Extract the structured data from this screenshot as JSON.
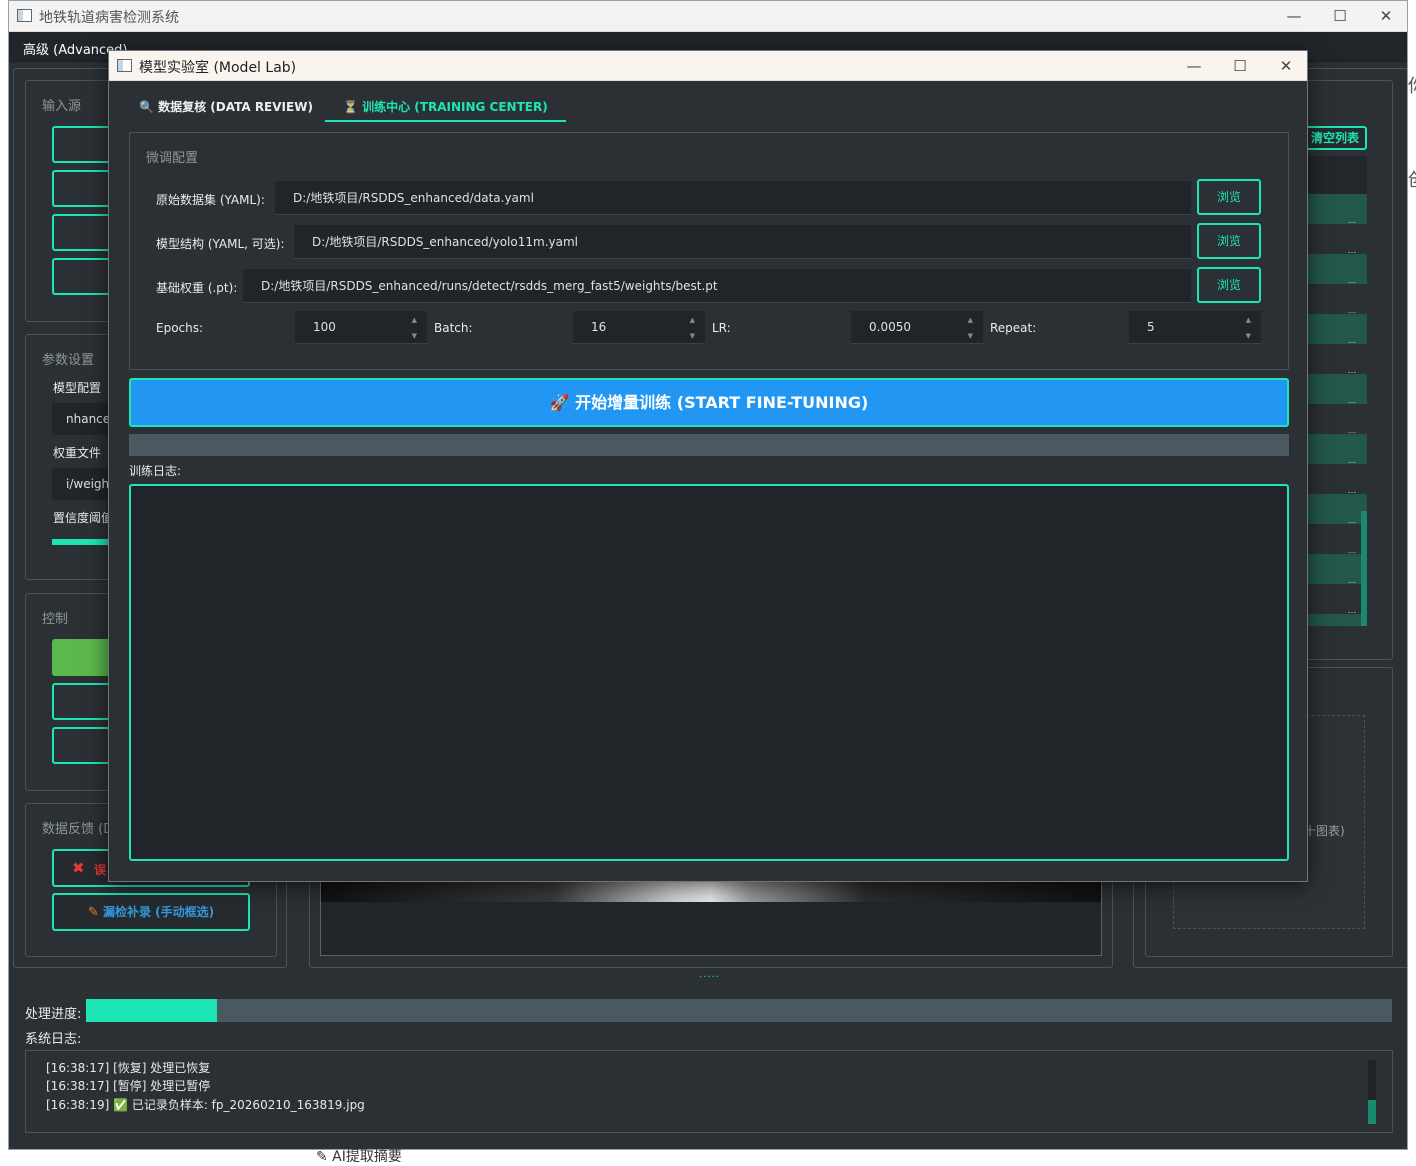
{
  "main_window": {
    "title": "地铁轨道病害检测系统",
    "menu": "高级 (Advanced)",
    "left_panel": {
      "input_group": "输入源",
      "params_group": "参数设置",
      "model_config": "模型配置",
      "model_value": "nhance",
      "weights_label": "权重文件",
      "weights_value": "i/weigh",
      "conf_label": "置信度阈值",
      "control_group": "控制",
      "feedback_group": "数据反馈 (D",
      "false_btn": "误",
      "miss_btn": "漏检补录 (手动框选)"
    },
    "right_panel": {
      "clear_btn": "清空列表",
      "chart_text": "十图表)",
      "side_char_1": "你",
      "side_char_2": "创"
    },
    "bottom_text": "✎ AI提取摘要",
    "progress_label": "处理进度:",
    "progress": 0.1,
    "syslog_label": "系统日志:",
    "logs": [
      "[16:38:17] [恢复] 处理已恢复",
      "[16:38:17] [暂停] 处理已暂停",
      "[16:38:19] ✅ 已记录负样本: fp_20260210_163819.jpg"
    ],
    "splitter": "....."
  },
  "dialog": {
    "title": "模型实验室 (Model Lab)",
    "tabs": [
      "🔍 数据复核 (DATA REVIEW)",
      "⏳ 训练中心 (TRAINING CENTER)"
    ],
    "group_title": "微调配置",
    "dataset_label": "原始数据集 (YAML):",
    "dataset_value": "D:/地铁项目/RSDDS_enhanced/data.yaml",
    "model_label": "模型结构 (YAML, 可选):",
    "model_value": "D:/地铁项目/RSDDS_enhanced/yolo11m.yaml",
    "weights_label": "基础权重 (.pt):",
    "weights_value": "D:/地铁项目/RSDDS_enhanced/runs/detect/rsdds_merg_fast5/weights/best.pt",
    "browse": "浏览",
    "epochs_label": "Epochs:",
    "epochs": "100",
    "batch_label": "Batch:",
    "batch": "16",
    "lr_label": "LR:",
    "lr": "0.0050",
    "repeat_label": "Repeat:",
    "repeat": "5",
    "start_btn": "🚀 开始增量训练 (START FINE-TUNING)",
    "log_label": "训练日志:"
  },
  "colors": {
    "accent": "#1ee5b5",
    "primary": "#2196f3",
    "bg": "#2b3034"
  }
}
